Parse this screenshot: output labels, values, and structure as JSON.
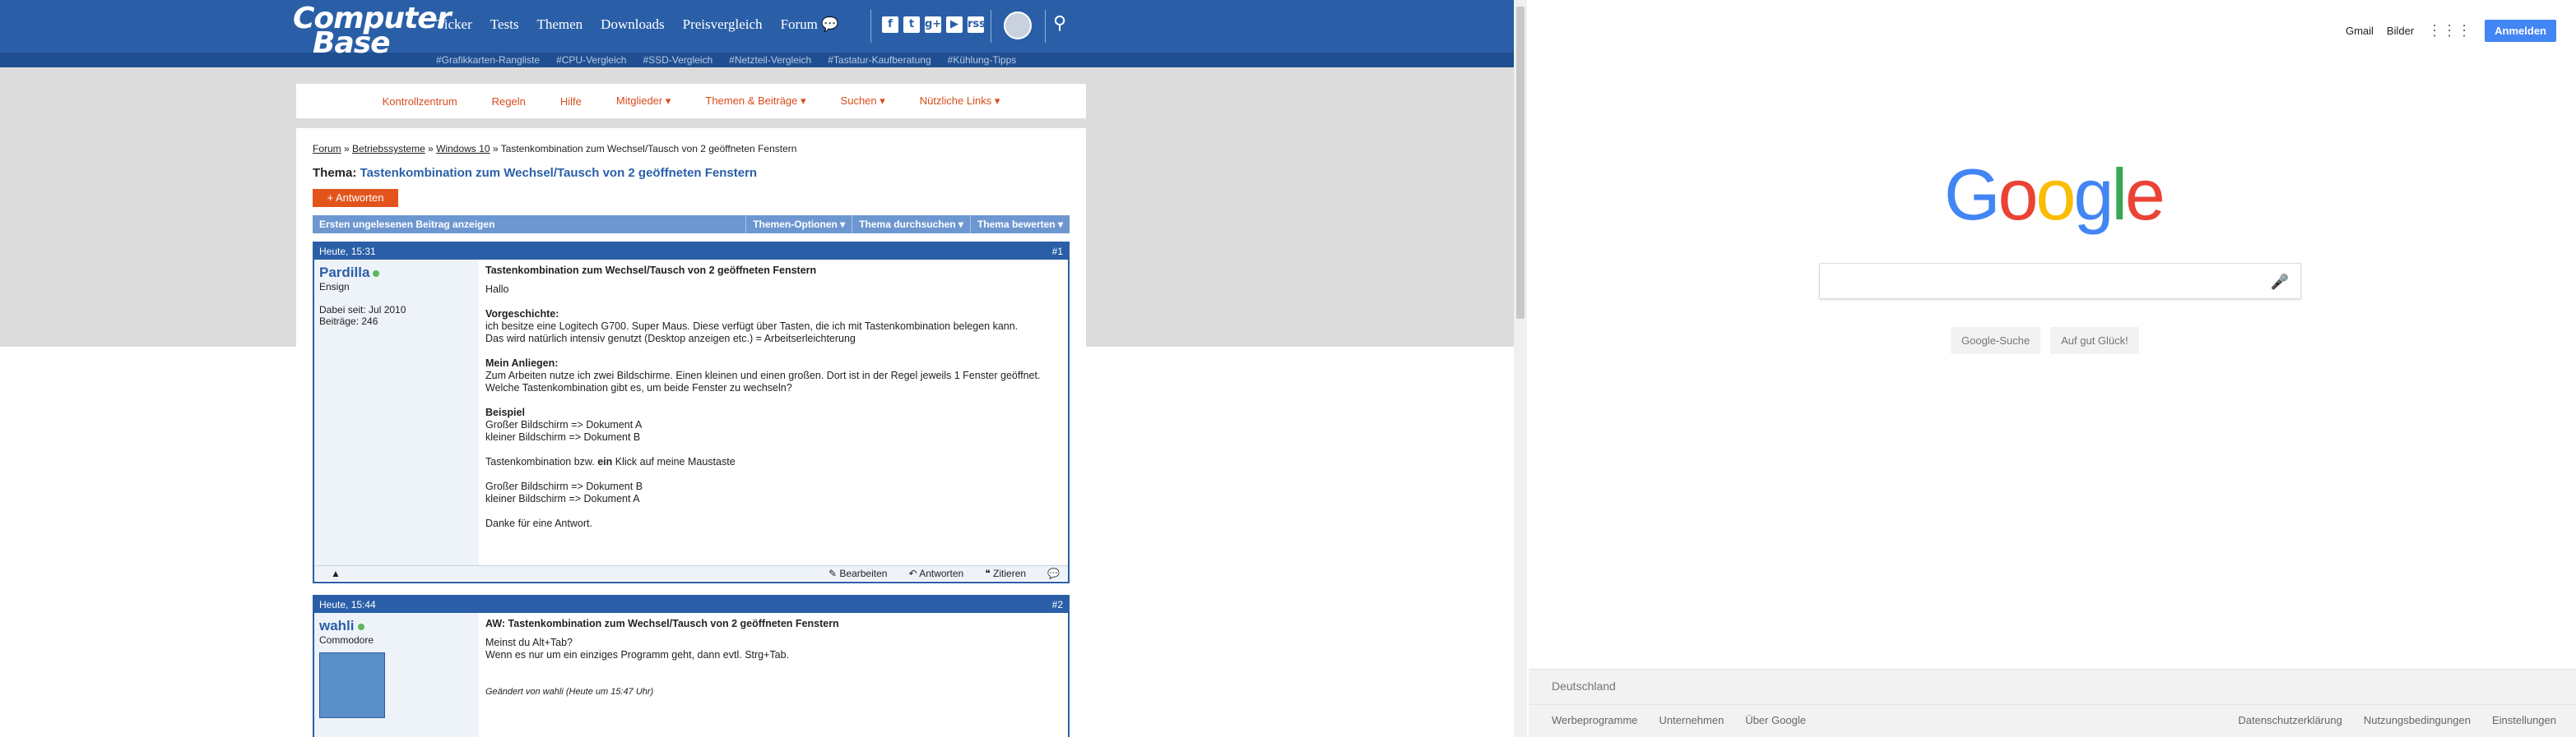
{
  "forum": {
    "logo": {
      "line1": "Computer",
      "line2": "Base"
    },
    "nav": [
      "Ticker",
      "Tests",
      "Themen",
      "Downloads",
      "Preisvergleich",
      "Forum"
    ],
    "socials": [
      "f",
      "t",
      "g+",
      "▶",
      "rss"
    ],
    "hashtags": [
      "#Grafikkarten-Rangliste",
      "#CPU-Vergleich",
      "#SSD-Vergleich",
      "#Netzteil-Vergleich",
      "#Tastatur-Kaufberatung",
      "#Kühlung-Tipps"
    ],
    "subnav": [
      "Kontrollzentrum",
      "Regeln",
      "Hilfe",
      "Mitglieder ▾",
      "Themen & Beiträge ▾",
      "Suchen ▾",
      "Nützliche Links ▾"
    ],
    "breadcrumb": {
      "b1": "Forum",
      "b2": "Betriebssysteme",
      "b3": "Windows 10",
      "current": "Tastenkombination zum Wechsel/Tausch von 2 geöffneten Fenstern",
      "sep": "»"
    },
    "thread": {
      "prefix": "Thema:",
      "title": "Tastenkombination zum Wechsel/Tausch von 2 geöffneten Fenstern"
    },
    "reply_button": "+ Antworten",
    "options": {
      "first_unread": "Ersten ungelesenen Beitrag anzeigen",
      "o1": "Themen-Optionen ▾",
      "o2": "Thema durchsuchen ▾",
      "o3": "Thema bewerten ▾"
    },
    "post1": {
      "date": "Heute, 15:31",
      "num": "#1",
      "user": "Pardilla",
      "rank": "Ensign",
      "since": "Dabei seit: Jul 2010",
      "posts": "Beiträge: 246",
      "title": "Tastenkombination zum Wechsel/Tausch von 2 geöffneten Fenstern",
      "lines": {
        "hello": "Hallo",
        "h1": "Vorgeschichte:",
        "p1a": "ich besitze eine Logitech G700. Super Maus. Diese verfügt über Tasten, die ich mit Tastenkombination belegen kann.",
        "p1b": "Das wird natürlich intensiv genutzt (Desktop anzeigen etc.) = Arbeitserleichterung",
        "h2": "Mein Anliegen:",
        "p2a": "Zum Arbeiten nutze ich zwei Bildschirme. Einen kleinen und einen großen. Dort ist in der Regel jeweils 1 Fenster geöffnet.",
        "p2b": "Welche Tastenkombination gibt es, um beide Fenster zu wechseln?",
        "h3": "Beispiel",
        "e1": "Großer Bildschirm => Dokument A",
        "e2": "kleiner Bildschirm => Dokument B",
        "mid_a": "Tastenkombination bzw.",
        "mid_b": "ein",
        "mid_c": "Klick auf meine Maustaste",
        "f1": "Großer Bildschirm => Dokument B",
        "f2": "kleiner Bildschirm => Dokument A",
        "thanks": "Danke für eine Antwort."
      },
      "actions": {
        "edit": "Bearbeiten",
        "reply": "Antworten",
        "quote": "Zitieren"
      }
    },
    "post2": {
      "date": "Heute, 15:44",
      "num": "#2",
      "user": "wahli",
      "rank": "Commodore",
      "title": "AW: Tastenkombination zum Wechsel/Tausch von 2 geöffneten Fenstern",
      "l1": "Meinst du Alt+Tab?",
      "l2": "Wenn es nur um ein einziges Programm geht, dann evtl. Strg+Tab.",
      "edited": "Geändert von wahli (Heute um 15:47 Uhr)"
    }
  },
  "google": {
    "top": {
      "gmail": "Gmail",
      "images": "Bilder",
      "signin": "Anmelden"
    },
    "logo": {
      "G": "G",
      "o1": "o",
      "o2": "o",
      "g": "g",
      "l": "l",
      "e": "e"
    },
    "buttons": {
      "search": "Google-Suche",
      "lucky": "Auf gut Glück!"
    },
    "country": "Deutschland",
    "footer_left": [
      "Werbeprogramme",
      "Unternehmen",
      "Über Google"
    ],
    "footer_right": [
      "Datenschutzerklärung",
      "Nutzungsbedingungen",
      "Einstellungen"
    ],
    "colors": {
      "blue": "#4285F4",
      "red": "#EA4335",
      "yellow": "#FBBC05",
      "green": "#34A853"
    }
  }
}
